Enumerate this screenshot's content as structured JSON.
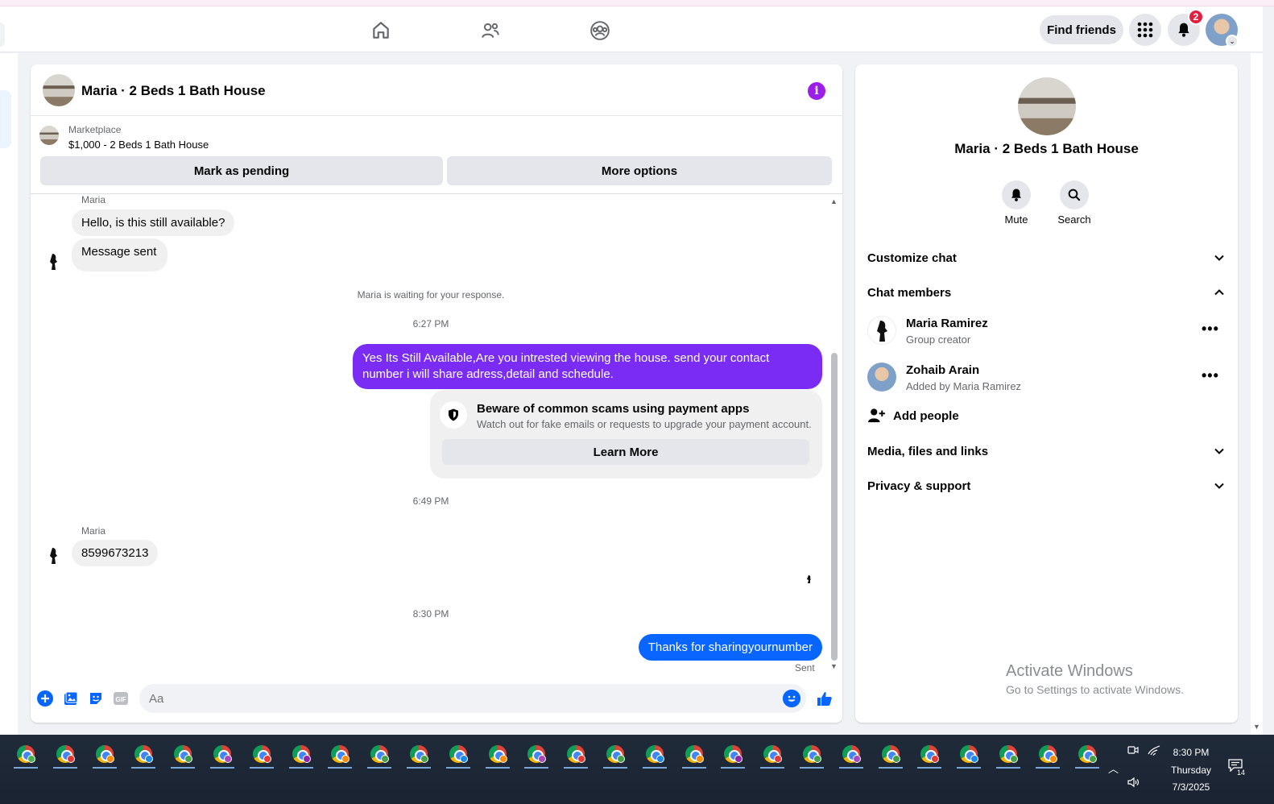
{
  "navbar": {
    "find_friends": "Find friends",
    "notification_count": "2"
  },
  "chat": {
    "title": "Maria · 2 Beds 1 Bath House",
    "marketplace_label": "Marketplace",
    "listing": "$1,000 - 2 Beds 1 Bath House",
    "mark_pending": "Mark as pending",
    "more_options": "More options",
    "sender1": "Maria",
    "msg1": "Hello, is this still available?",
    "msg2": "Message sent",
    "waiting": "Maria is waiting for your response.",
    "time1": "6:27 PM",
    "reply1": "Yes Its Still Available,Are you intrested viewing the house. send your contact number i will share adress,detail and schedule.",
    "scam_title": "Beware of common scams using payment apps",
    "scam_desc": "Watch out for fake emails or requests to upgrade your payment account.",
    "learn_more": "Learn More",
    "time2": "6:49 PM",
    "sender2": "Maria",
    "msg3": "8599673213",
    "time3": "8:30 PM",
    "reply2": "Thanks for sharingyournumber",
    "sent": "Sent",
    "composer_placeholder": "Aa"
  },
  "details": {
    "title": "Maria · 2 Beds 1 Bath House",
    "mute": "Mute",
    "search": "Search",
    "customize": "Customize chat",
    "members_header": "Chat members",
    "members": [
      {
        "name": "Maria Ramirez",
        "sub": "Group creator"
      },
      {
        "name": "Zohaib Arain",
        "sub": "Added by Maria Ramirez"
      }
    ],
    "add_people": "Add people",
    "media": "Media, files and links",
    "privacy": "Privacy & support"
  },
  "watermark": {
    "line1": "Activate Windows",
    "line2": "Go to Settings to activate Windows."
  },
  "taskbar": {
    "time": "8:30 PM",
    "day": "Thursday",
    "date": "7/3/2025",
    "notif_count": "14"
  },
  "colors": {
    "purple_bubble": "#7a2cf5",
    "blue_bubble": "#0866ff",
    "info_icon": "#9b1fe8",
    "badge": "#e41e3f"
  }
}
